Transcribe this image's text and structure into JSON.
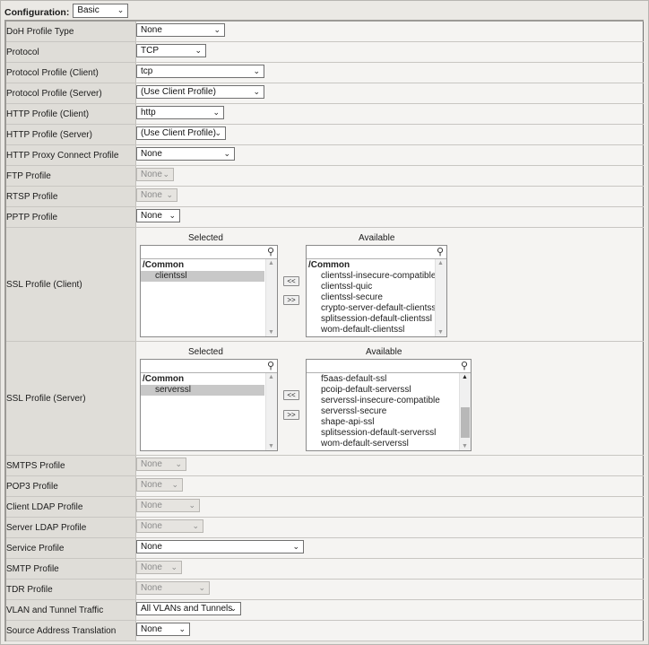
{
  "config": {
    "label": "Configuration:",
    "value": "Basic"
  },
  "rows": [
    {
      "label": "DoH Profile Type",
      "value": "None"
    },
    {
      "label": "Protocol",
      "value": "TCP"
    },
    {
      "label": "Protocol Profile (Client)",
      "value": "tcp"
    },
    {
      "label": "Protocol Profile (Server)",
      "value": "(Use Client Profile)"
    },
    {
      "label": "HTTP Profile (Client)",
      "value": "http"
    },
    {
      "label": "HTTP Profile (Server)",
      "value": "(Use Client Profile)"
    },
    {
      "label": "HTTP Proxy Connect Profile",
      "value": "None"
    },
    {
      "label": "FTP Profile",
      "value": "None",
      "disabled": true
    },
    {
      "label": "RTSP Profile",
      "value": "None",
      "disabled": true
    },
    {
      "label": "PPTP Profile",
      "value": "None"
    }
  ],
  "ssl_client": {
    "label": "SSL Profile (Client)",
    "selected_title": "Selected",
    "available_title": "Available",
    "selected_items": [
      "/Common",
      "clientssl"
    ],
    "available_items": [
      "/Common",
      "clientssl-insecure-compatible",
      "clientssl-quic",
      "clientssl-secure",
      "crypto-server-default-clientssl",
      "splitsession-default-clientssl",
      "wom-default-clientssl"
    ],
    "move_left": "<<",
    "move_right": ">>"
  },
  "ssl_server": {
    "label": "SSL Profile (Server)",
    "selected_title": "Selected",
    "available_title": "Available",
    "selected_items": [
      "/Common",
      "serverssl"
    ],
    "available_items": [
      "f5aas-default-ssl",
      "pcoip-default-serverssl",
      "serverssl-insecure-compatible",
      "serverssl-secure",
      "shape-api-ssl",
      "splitsession-default-serverssl",
      "wom-default-serverssl"
    ],
    "move_left": "<<",
    "move_right": ">>"
  },
  "rows2": [
    {
      "label": "SMTPS Profile",
      "value": "None",
      "disabled": true
    },
    {
      "label": "POP3 Profile",
      "value": "None",
      "disabled": true
    },
    {
      "label": "Client LDAP Profile",
      "value": "None",
      "disabled": true
    },
    {
      "label": "Server LDAP Profile",
      "value": "None",
      "disabled": true
    },
    {
      "label": "Service Profile",
      "value": "None"
    },
    {
      "label": "SMTP Profile",
      "value": "None",
      "disabled": true
    },
    {
      "label": "TDR Profile",
      "value": "None",
      "disabled": true
    },
    {
      "label": "VLAN and Tunnel Traffic",
      "value": "All VLANs and Tunnels"
    },
    {
      "label": "Source Address Translation",
      "value": "None"
    }
  ]
}
